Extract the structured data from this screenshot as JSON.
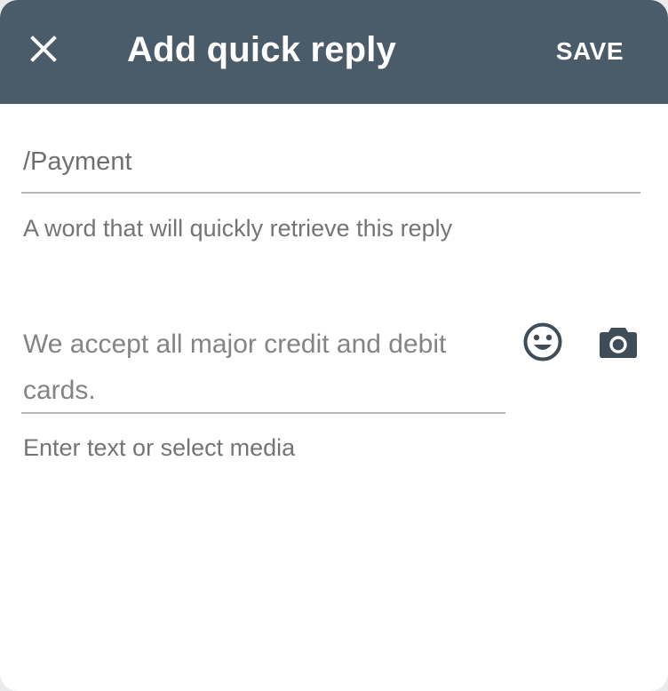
{
  "appbar": {
    "title": "Add quick reply",
    "save_label": "SAVE",
    "close_icon": "close-icon",
    "background": "#4a5b6a"
  },
  "shortcut": {
    "value": "/Payment",
    "helper": "A word that will quickly retrieve this reply"
  },
  "message": {
    "value": "We accept all major credit and debit cards.",
    "helper": "Enter text or select media",
    "emoji_icon": "emoji-icon",
    "camera_icon": "camera-icon"
  }
}
